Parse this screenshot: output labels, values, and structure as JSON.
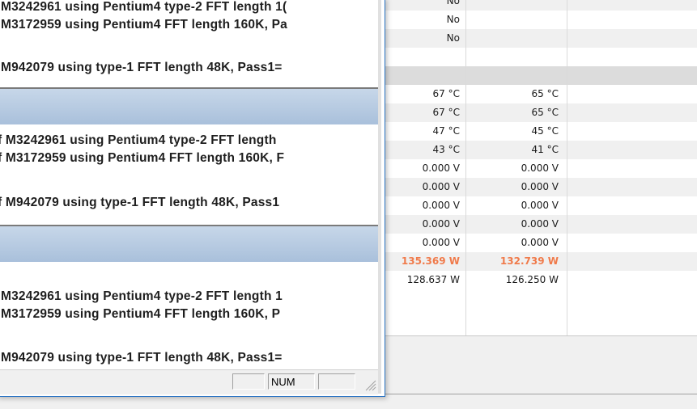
{
  "sensor_table": {
    "rows": [
      {
        "type": "value",
        "c1": "No",
        "c2": "",
        "style": "alt"
      },
      {
        "type": "value",
        "c1": "No",
        "c2": "",
        "style": ""
      },
      {
        "type": "value",
        "c1": "No",
        "c2": "",
        "style": "alt"
      },
      {
        "type": "value",
        "c1": "",
        "c2": "",
        "style": ""
      },
      {
        "type": "header",
        "c1": "",
        "c2": "",
        "style": "header"
      },
      {
        "type": "value",
        "c1": "67 °C",
        "c2": "65 °C",
        "style": ""
      },
      {
        "type": "value",
        "c1": "67 °C",
        "c2": "65 °C",
        "style": "alt"
      },
      {
        "type": "value",
        "c1": "47 °C",
        "c2": "45 °C",
        "style": ""
      },
      {
        "type": "value",
        "c1": "43 °C",
        "c2": "41 °C",
        "style": "alt"
      },
      {
        "type": "value",
        "c1": "0.000 V",
        "c2": "0.000 V",
        "style": ""
      },
      {
        "type": "value",
        "c1": "0.000 V",
        "c2": "0.000 V",
        "style": "alt"
      },
      {
        "type": "value",
        "c1": "0.000 V",
        "c2": "0.000 V",
        "style": ""
      },
      {
        "type": "value",
        "c1": "0.000 V",
        "c2": "0.000 V",
        "style": "alt"
      },
      {
        "type": "value",
        "c1": "0.000 V",
        "c2": "0.000 V",
        "style": ""
      },
      {
        "type": "value",
        "c1": "135.369 W",
        "c2": "132.739 W",
        "style": "alt",
        "highlight": true
      },
      {
        "type": "value",
        "c1": "128.637 W",
        "c2": "126.250 W",
        "style": ""
      }
    ]
  },
  "worker_window": {
    "pane1_lines": [
      "M3242961 using Pentium4 type-2 FFT length 1(",
      "M3172959 using Pentium4 FFT length 160K, Pa",
      "",
      "M942079 using type-1 FFT length 48K, Pass1="
    ],
    "pane2_lines": [
      "f M3242961 using Pentium4 type-2 FFT length",
      "f M3172959 using Pentium4 FFT length 160K, F",
      "",
      "f M942079 using type-1 FFT length 48K, Pass1"
    ],
    "pane3_lines": [
      "M3242961 using Pentium4 type-2 FFT length 1",
      "M3172959 using Pentium4 FFT length 160K, P",
      "",
      "M942079 using type-1 FFT length 48K, Pass1="
    ],
    "status": {
      "panel1": "",
      "panel2": "NUM",
      "panel3": ""
    }
  },
  "colors": {
    "highlight": "#f07a4a",
    "pane_title_top": "#c7d7e9",
    "pane_title_bottom": "#a9c0db",
    "window_border": "#2a74c4"
  }
}
